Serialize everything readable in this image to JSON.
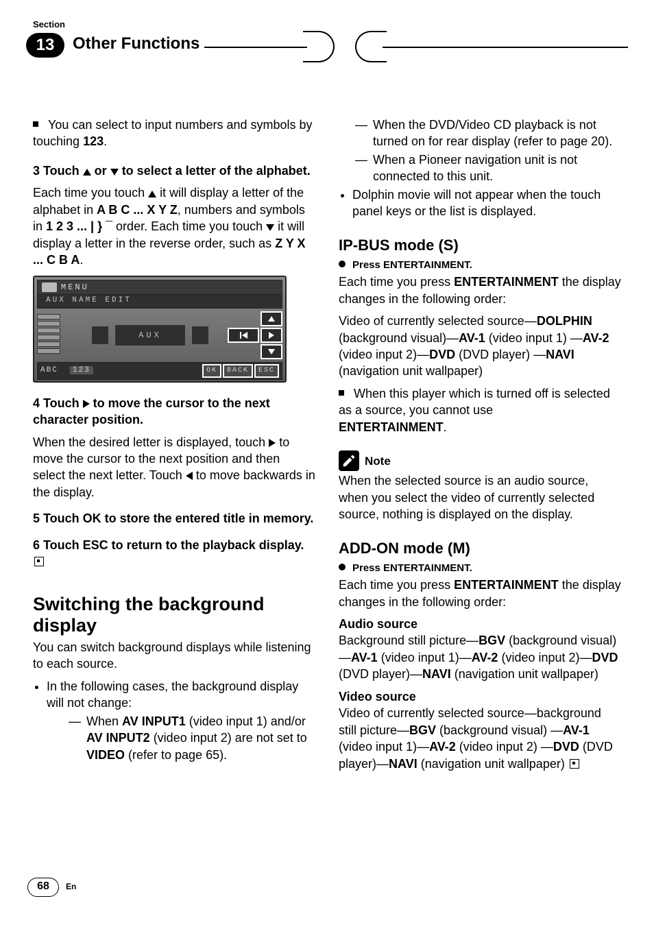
{
  "header": {
    "section_label": "Section",
    "chapter_number": "13",
    "chapter_title": "Other Functions"
  },
  "left": {
    "tip1_a": "You can select to input numbers and symbols by touching ",
    "tip1_b": "123",
    "tip1_c": ".",
    "step3_head": "3   Touch ",
    "step3_mid": " or ",
    "step3_tail": " to select a letter of the alphabet.",
    "step3_body_a": "Each time you touch ",
    "step3_body_b": " it will display a letter of the alphabet in ",
    "step3_body_c": "A B C ... X Y Z",
    "step3_body_d": ", numbers and symbols in ",
    "step3_body_e": "1 2 3 ... | } ¯",
    "step3_body_f": " order. Each time you touch ",
    "step3_body_g": " it will display a letter in the reverse order, such as ",
    "step3_body_h": "Z Y X ... C B A",
    "step3_body_i": ".",
    "lcd": {
      "menu": "MENU",
      "sub": "AUX  NAME  EDIT",
      "aux": "AUX",
      "abc": "ABC",
      "num": "123",
      "ok": "OK",
      "back": "BACK",
      "esc": "ESC"
    },
    "step4_head": "4   Touch ",
    "step4_tail": " to move the cursor to the next character position.",
    "step4_body_a": "When the desired letter is displayed, touch ",
    "step4_body_b": " to move the cursor to the next position and then select the next letter. Touch ",
    "step4_body_c": " to move backwards in the display.",
    "step5": "5   Touch OK to store the entered title in memory.",
    "step6": "6   Touch ESC to return to the playback display.",
    "h2": "Switching the background display",
    "intro": "You can switch background displays while listening to each source.",
    "b1": "In the following cases, the background display will not change:",
    "d1_a": "When ",
    "d1_b": "AV INPUT1",
    "d1_c": " (video input 1) and/or ",
    "d1_d": "AV INPUT2",
    "d1_e": " (video input 2) are not set to ",
    "d1_f": "VIDEO",
    "d1_g": " (refer to page 65)."
  },
  "right": {
    "d2": "When the DVD/Video CD playback is not turned on for rear display (refer to page 20).",
    "d3": "When a Pioneer navigation unit is not connected to this unit.",
    "b2": "Dolphin movie will not appear when the touch panel keys or the list is displayed.",
    "h3a": "IP-BUS mode (S)",
    "press": "Press ENTERTAINMENT.",
    "ip_a": "Each time you press ",
    "ip_b": "ENTERTAINMENT",
    "ip_c": " the display changes in the following order:",
    "ip_seq_a": "Video of currently selected source—",
    "ip_seq_b": "DOLPHIN",
    "ip_seq_c": " (background visual)—",
    "ip_seq_d": "AV-1",
    "ip_seq_e": " (video input 1) —",
    "ip_seq_f": "AV-2",
    "ip_seq_g": " (video input 2)—",
    "ip_seq_h": "DVD",
    "ip_seq_i": " (DVD player) —",
    "ip_seq_j": "NAVI",
    "ip_seq_k": " (navigation unit wallpaper)",
    "ip_tip_a": "When this player which is turned off is selected as a source, you cannot use ",
    "ip_tip_b": "ENTERTAINMENT",
    "ip_tip_c": ".",
    "note_label": "Note",
    "note_body": "When the selected source is an audio source, when you select the video of currently selected source, nothing is displayed on the display.",
    "h3b": "ADD-ON mode (M)",
    "add_a": "Each time you press ",
    "add_b": "ENTERTAINMENT",
    "add_c": " the display changes in the following order:",
    "audio_label": "Audio source",
    "audio_seq_a": "Background still picture—",
    "audio_seq_b": "BGV",
    "audio_seq_c": " (background visual)—",
    "audio_seq_d": "AV-1",
    "audio_seq_e": " (video input 1)—",
    "audio_seq_f": "AV-2",
    "audio_seq_g": " (video input 2)—",
    "audio_seq_h": "DVD",
    "audio_seq_i": " (DVD player)—",
    "audio_seq_j": "NAVI",
    "audio_seq_k": " (navigation unit wallpaper)",
    "video_label": "Video source",
    "video_seq_a": "Video of currently selected source—background still picture—",
    "video_seq_b": "BGV",
    "video_seq_c": " (background visual) —",
    "video_seq_d": "AV-1",
    "video_seq_e": " (video input 1)—",
    "video_seq_f": "AV-2",
    "video_seq_g": " (video input 2) —",
    "video_seq_h": "DVD",
    "video_seq_i": " (DVD player)—",
    "video_seq_j": "NAVI",
    "video_seq_k": " (navigation unit wallpaper)"
  },
  "footer": {
    "page": "68",
    "lang": "En"
  }
}
